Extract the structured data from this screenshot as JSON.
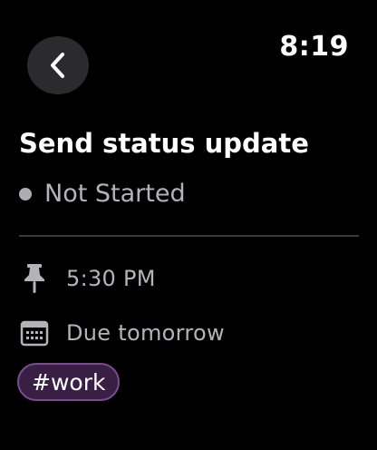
{
  "header": {
    "clock": "8:19",
    "back_icon": "chevron-left-icon"
  },
  "task": {
    "title": "Send status update",
    "status": "Not Started",
    "status_color": "#aeaeb2",
    "time": "5:30 PM",
    "time_icon": "pin-icon",
    "due": "Due tomorrow",
    "due_icon": "calendar-icon",
    "tag": "#work",
    "tag_color": "#7c4a8f"
  }
}
